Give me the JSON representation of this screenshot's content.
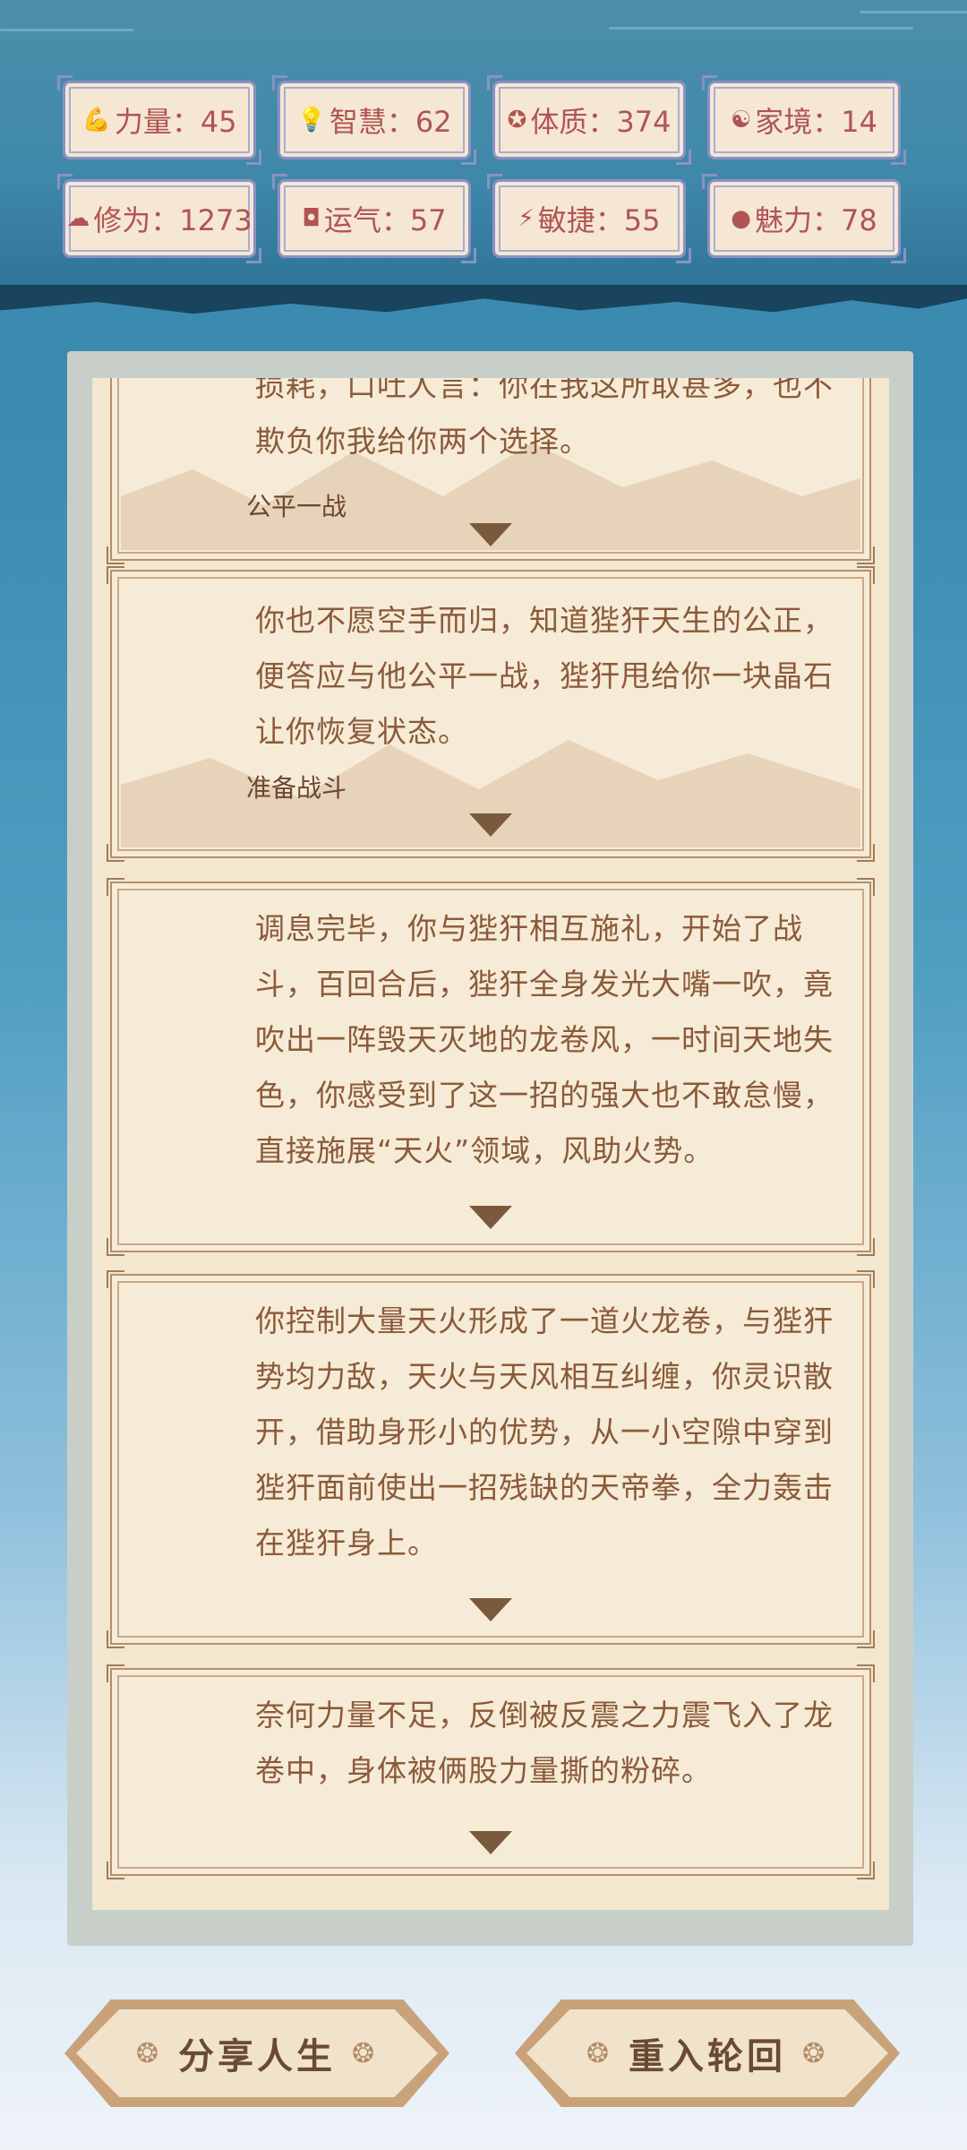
{
  "stats": [
    {
      "icon": "strength-icon",
      "glyph": "💪",
      "label": "力量：45"
    },
    {
      "icon": "wisdom-icon",
      "glyph": "💡",
      "label": "智慧：62"
    },
    {
      "icon": "constitution-icon",
      "glyph": "✪",
      "label": "体质：374"
    },
    {
      "icon": "family-icon",
      "glyph": "☯",
      "label": "家境：14"
    },
    {
      "icon": "cultivation-icon",
      "glyph": "☁",
      "label": "修为：1273"
    },
    {
      "icon": "luck-icon",
      "glyph": "◘",
      "label": "运气：57"
    },
    {
      "icon": "agility-icon",
      "glyph": "⚡",
      "label": "敏捷：55"
    },
    {
      "icon": "charm-icon",
      "glyph": "●",
      "label": "魅力：78"
    }
  ],
  "story": [
    {
      "text": "损耗，口吐人言：你在我这所取甚多，也不欺负你我给你两个选择。",
      "choice": "公平一战"
    },
    {
      "text": "你也不愿空手而归，知道狴犴天生的公正，便答应与他公平一战，狴犴甩给你一块晶石让你恢复状态。",
      "choice": "准备战斗"
    },
    {
      "text": "调息完毕，你与狴犴相互施礼，开始了战斗，百回合后，狴犴全身发光大嘴一吹，竟吹出一阵毁天灭地的龙卷风，一时间天地失色，你感受到了这一招的强大也不敢怠慢，直接施展“天火”领域，风助火势。",
      "choice": ""
    },
    {
      "text": "你控制大量天火形成了一道火龙卷，与狴犴势均力敌，天火与天风相互纠缠，你灵识散开，借助身形小的优势，从一小空隙中穿到狴犴面前使出一招残缺的天帝拳，全力轰击在狴犴身上。",
      "choice": ""
    },
    {
      "text": "奈何力量不足，反倒被反震之力震飞入了龙卷中，身体被俩股力量撕的粉碎。",
      "choice": ""
    }
  ],
  "buttons": {
    "share": "分享人生",
    "reincarnate": "重入轮回"
  },
  "colors": {
    "stat_text": "#b05454",
    "story_text": "#8a5a3a",
    "paper": "#f6ebd6"
  }
}
